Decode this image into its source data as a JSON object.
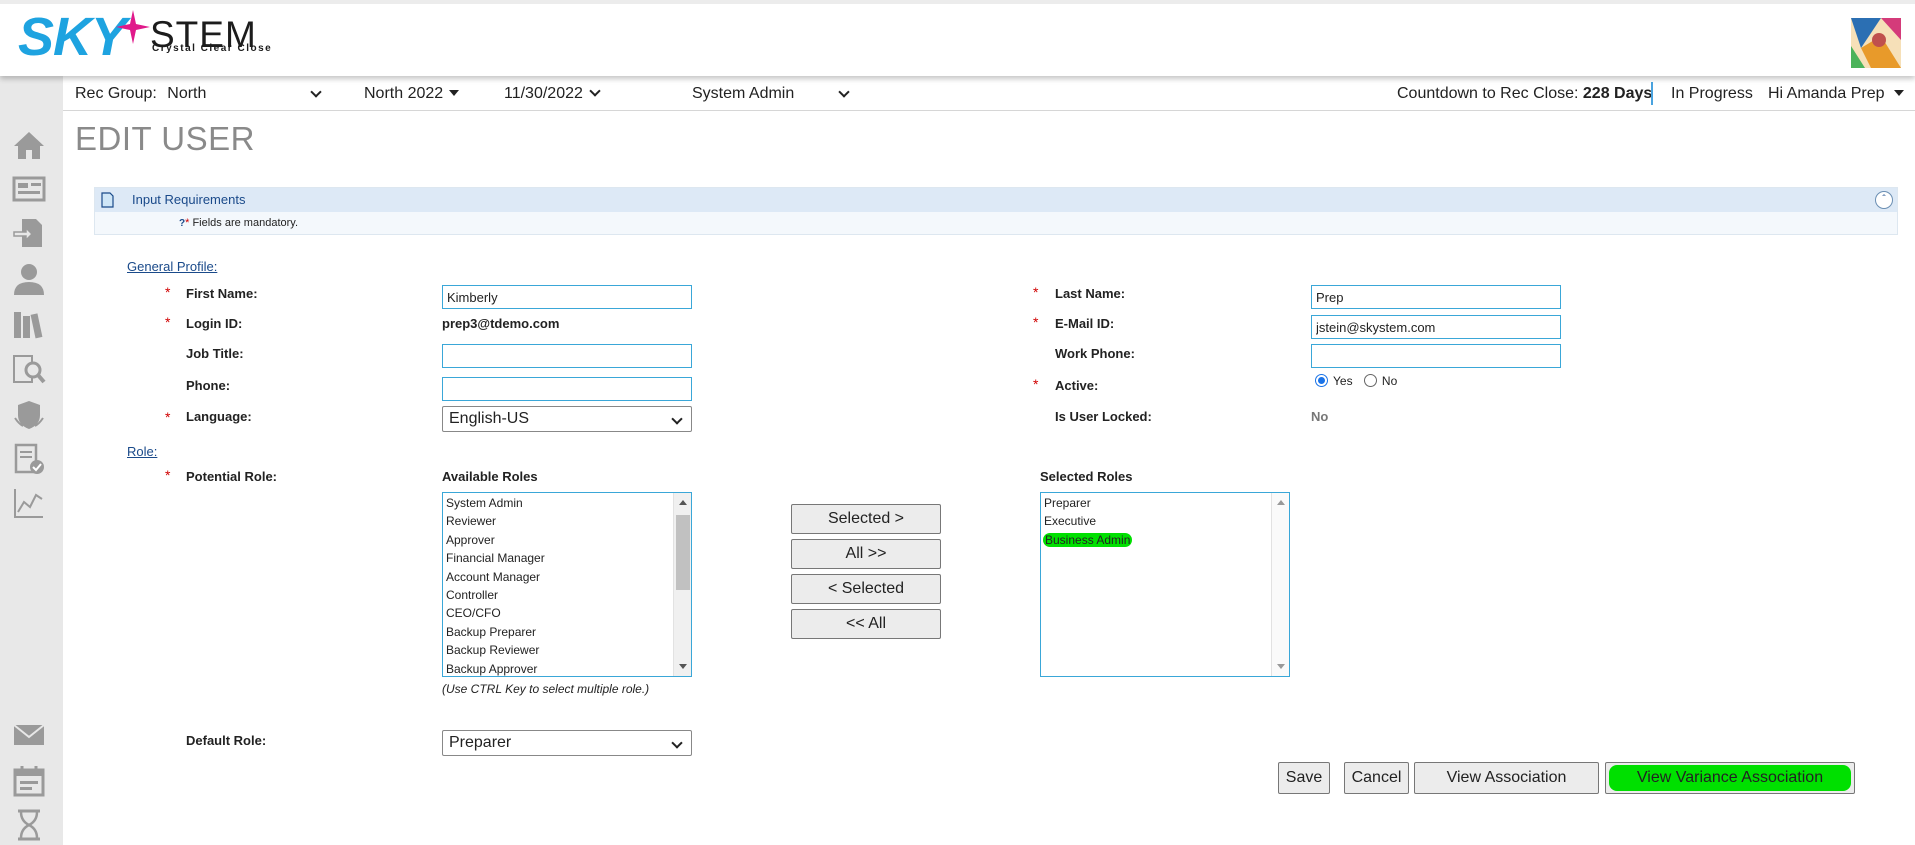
{
  "brand": {
    "logo_sky": "SKY",
    "logo_stem": "STEM",
    "tagline": "Crystal Clear Close"
  },
  "topbar": {
    "rec_group_label": "Rec Group:",
    "rec_group_value": "North",
    "period": "North 2022",
    "date": "11/30/2022",
    "role": "System Admin",
    "countdown_label": "Countdown to Rec Close:",
    "countdown_value": "228 Days",
    "status": "In Progress",
    "greeting": "Hi Amanda Prep"
  },
  "page": {
    "title": "EDIT USER"
  },
  "requirements": {
    "title": "Input Requirements",
    "help_glyph": "?",
    "star": "*",
    "note": "Fields are mandatory."
  },
  "general_profile": {
    "section_label": "General Profile:",
    "first_name_label": "First Name:",
    "first_name_value": "Kimberly",
    "last_name_label": "Last Name:",
    "last_name_value": "Prep",
    "login_id_label": "Login ID:",
    "login_id_value": "prep3@tdemo.com",
    "email_label": "E-Mail ID:",
    "email_value": "jstein@skystem.com",
    "job_title_label": "Job Title:",
    "job_title_value": "",
    "work_phone_label": "Work Phone:",
    "work_phone_value": "",
    "phone_label": "Phone:",
    "phone_value": "",
    "active_label": "Active:",
    "active_yes": "Yes",
    "active_no": "No",
    "active_selected": "Yes",
    "language_label": "Language:",
    "language_value": "English-US",
    "locked_label": "Is User Locked:",
    "locked_value": "No"
  },
  "roles": {
    "section_label": "Role:",
    "potential_label": "Potential Role:",
    "available_label": "Available Roles",
    "selected_label": "Selected Roles",
    "available": [
      "System Admin",
      "Reviewer",
      "Approver",
      "Financial Manager",
      "Account Manager",
      "Controller",
      "CEO/CFO",
      "Backup Preparer",
      "Backup Reviewer",
      "Backup Approver"
    ],
    "selected": [
      "Preparer",
      "Executive",
      "Business Admin"
    ],
    "hint": "(Use CTRL Key to select multiple role.)",
    "btn_selected": "Selected >",
    "btn_all": "All >>",
    "btn_unselected": "< Selected",
    "btn_unall": "<< All",
    "default_role_label": "Default Role:",
    "default_role_value": "Preparer"
  },
  "actions": {
    "save": "Save",
    "cancel": "Cancel",
    "view_association": "View Association",
    "view_variance_association": "View Variance Association"
  },
  "colors": {
    "brand_blue": "#1ea3e0",
    "accent_magenta": "#e0198a",
    "required_red": "#d00000",
    "link_blue": "#1a4a8a",
    "highlight_green": "#00e000"
  }
}
